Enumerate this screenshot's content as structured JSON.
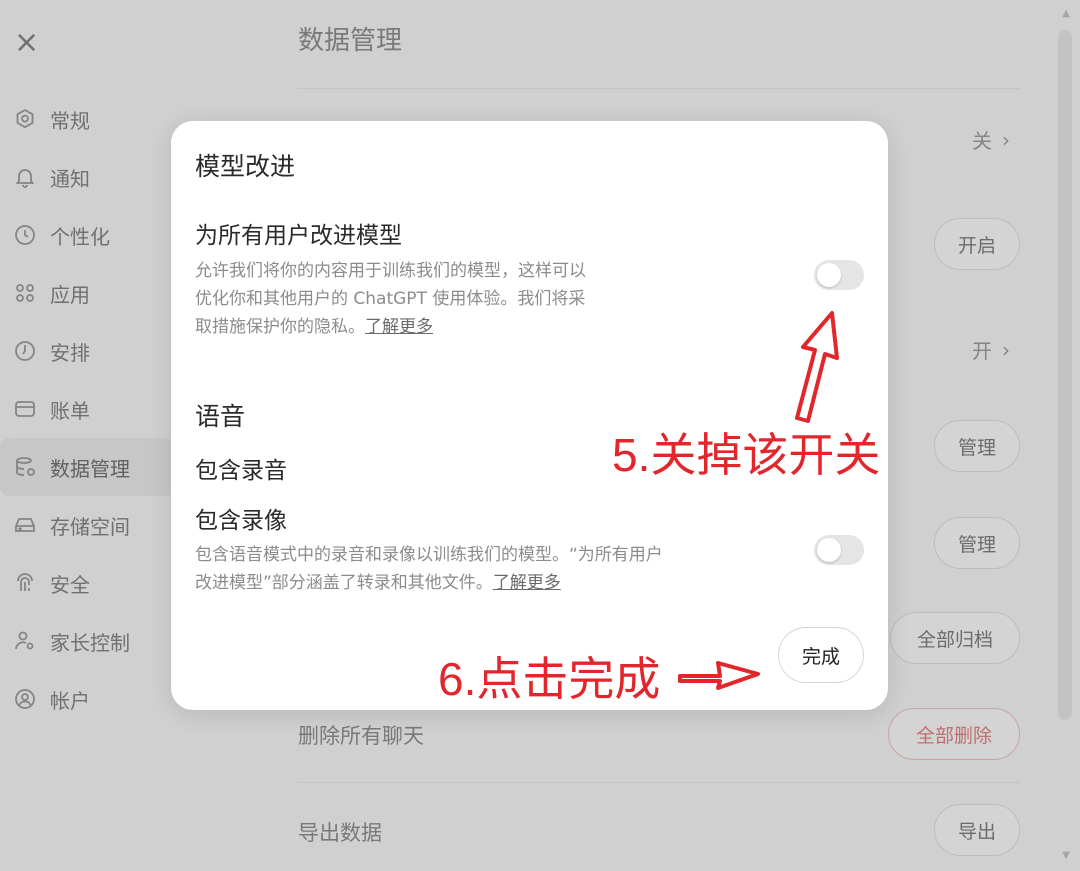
{
  "sidebar": {
    "close_icon": "×",
    "items": [
      {
        "label": "常规",
        "icon": "gear-icon"
      },
      {
        "label": "通知",
        "icon": "bell-icon"
      },
      {
        "label": "个性化",
        "icon": "personalize-icon"
      },
      {
        "label": "应用",
        "icon": "apps-grid-icon"
      },
      {
        "label": "安排",
        "icon": "clock-icon"
      },
      {
        "label": "账单",
        "icon": "card-icon"
      },
      {
        "label": "数据管理",
        "icon": "database-icon",
        "active": true
      },
      {
        "label": "存储空间",
        "icon": "storage-icon"
      },
      {
        "label": "安全",
        "icon": "fingerprint-icon"
      },
      {
        "label": "家长控制",
        "icon": "parental-icon"
      },
      {
        "label": "帐户",
        "icon": "account-icon"
      }
    ]
  },
  "main": {
    "title": "数据管理",
    "rows": {
      "r1_right": "关",
      "r2_button": "开启",
      "r3_right": "开",
      "r4_button": "管理",
      "r5_button": "管理",
      "r6_button": "全部归档",
      "delete_label": "删除所有聊天",
      "delete_button": "全部删除",
      "export_label": "导出数据",
      "export_button": "导出"
    }
  },
  "modal": {
    "title": "模型改进",
    "improve_heading": "为所有用户改进模型",
    "improve_desc": "允许我们将你的内容用于训练我们的模型，这样可以优化你和其他用户的 ChatGPT 使用体验。我们将采取措施保护你的隐私。",
    "improve_link": "了解更多",
    "improve_toggle_on": false,
    "voice_heading": "语音",
    "include_audio": "包含录音",
    "include_video": "包含录像",
    "voice_desc": "包含语音模式中的录音和录像以训练我们的模型。“为所有用户改进模型”部分涵盖了转录和其他文件。",
    "voice_link": "了解更多",
    "voice_toggle_on": false,
    "done_label": "完成"
  },
  "annotations": {
    "step5": "5.关掉该开关",
    "step6": "6.点击完成",
    "color": "#e1262c"
  }
}
